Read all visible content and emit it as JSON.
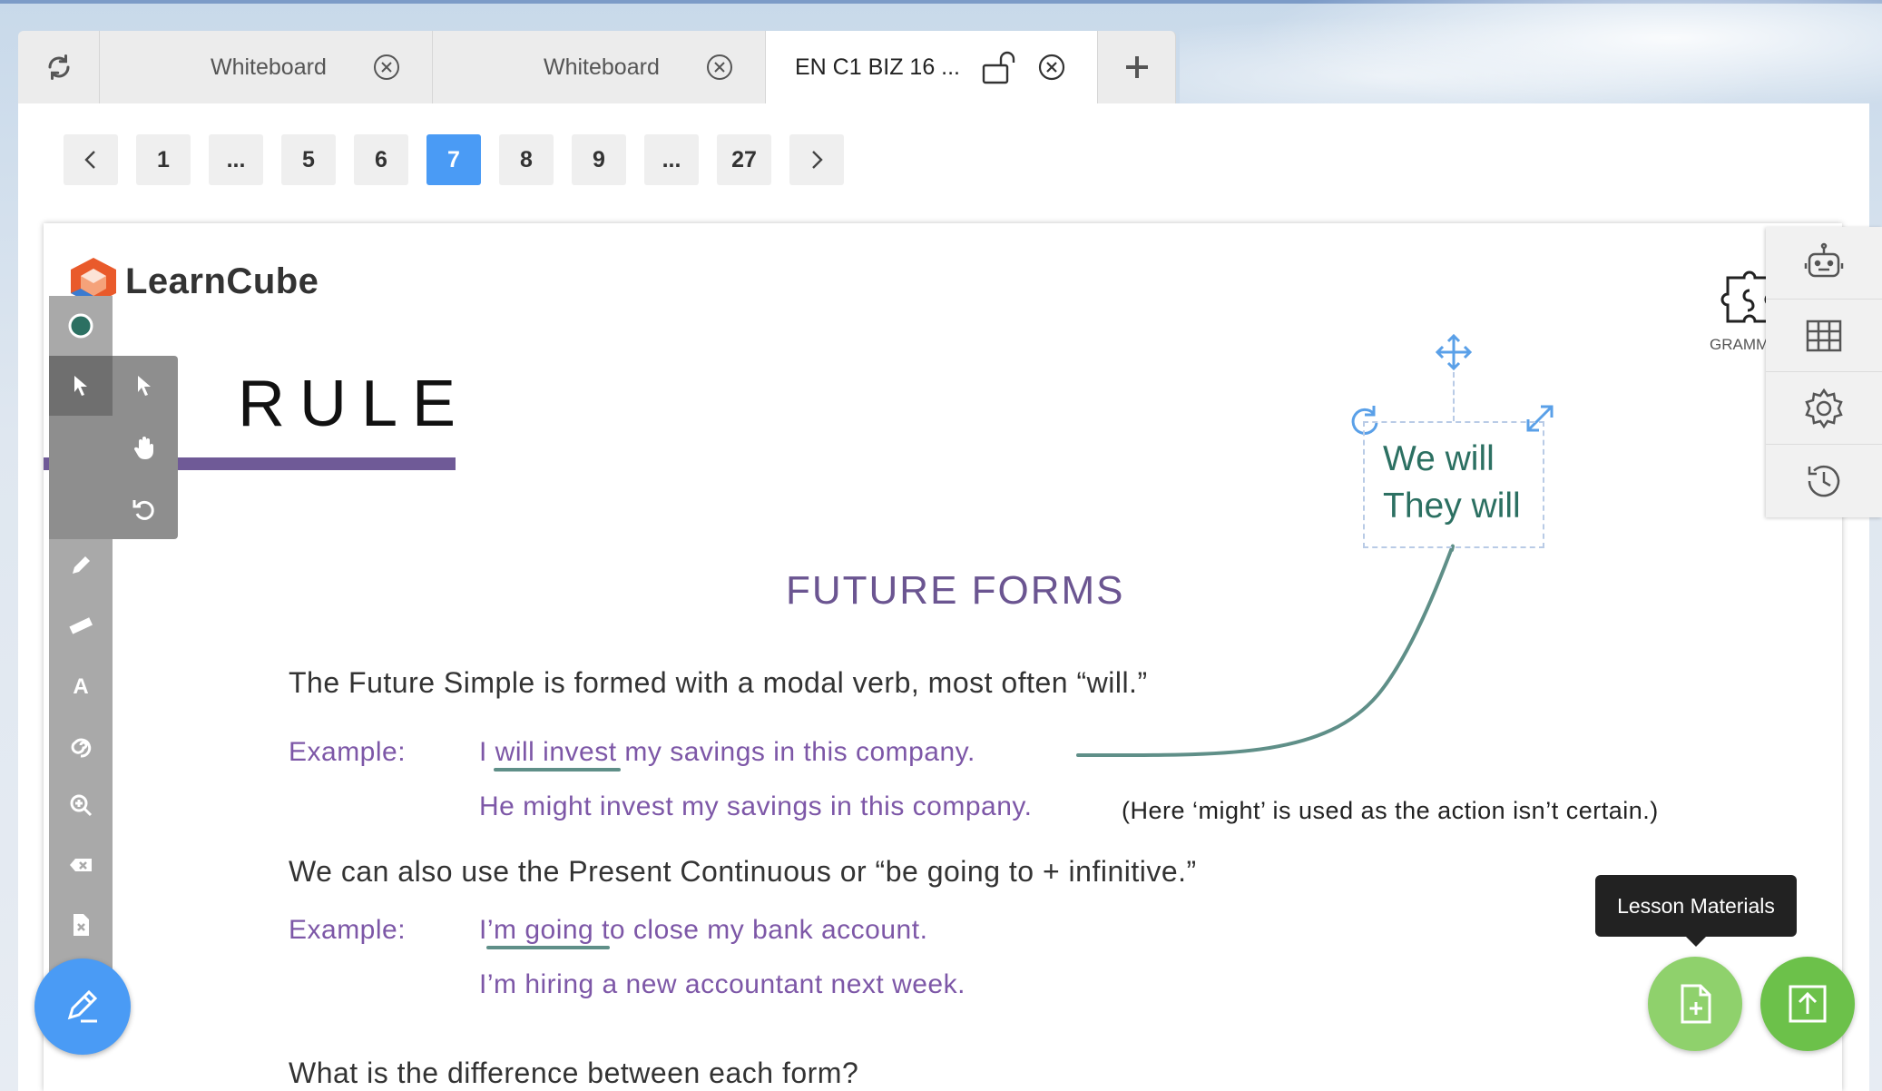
{
  "tabs": [
    {
      "label": "Whiteboard"
    },
    {
      "label": "Whiteboard"
    },
    {
      "label": "EN C1 BIZ 16 ..."
    }
  ],
  "pagination": {
    "pages": [
      "1",
      "...",
      "5",
      "6",
      "7",
      "8",
      "9",
      "...",
      "27"
    ],
    "current": "7"
  },
  "slide": {
    "logo": "LearnCube",
    "rule_title": "RULE",
    "heading": "FUTURE FORMS",
    "corner_label": "GRAMM",
    "para1": "The Future Simple is formed with a modal verb, most often “will.”",
    "example_label_1": "Example:",
    "example1_a": "I will invest my savings in this company.",
    "example1_b": "He might invest my savings in this company.",
    "note1": "(Here ‘might’ is used as the action isn’t certain.)",
    "para2": "We can also use the Present Continuous or “be going to + infinitive.”",
    "example_label_2": "Example:",
    "example2_a": "I’m going to close my bank account.",
    "example2_b": "I’m hiring a new accountant next week.",
    "para3": "What is the difference between each form?"
  },
  "sticky": {
    "line1": "We will",
    "line2": "They will"
  },
  "tooltip": "Lesson Materials",
  "colors": {
    "accent": "#4a9bf5",
    "purple": "#7d57a7",
    "teal": "#2c7062",
    "green": "#6cc14a"
  }
}
